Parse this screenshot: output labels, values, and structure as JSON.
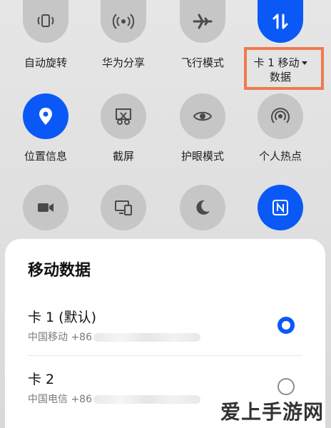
{
  "tiles": [
    {
      "label": "自动旋转",
      "icon": "rotate-lock-icon",
      "active": false
    },
    {
      "label": "华为分享",
      "icon": "share-signal-icon",
      "active": false
    },
    {
      "label": "飞行模式",
      "icon": "airplane-icon",
      "active": false
    },
    {
      "label_line1": "卡 1 移动",
      "label_line2": "数据",
      "icon": "mobile-data-icon",
      "active": true
    },
    {
      "label": "位置信息",
      "icon": "location-pin-icon",
      "active": true
    },
    {
      "label": "截屏",
      "icon": "screenshot-scissors-icon",
      "active": false
    },
    {
      "label": "护眼模式",
      "icon": "eye-icon",
      "active": false
    },
    {
      "label": "个人热点",
      "icon": "hotspot-icon",
      "active": false
    },
    {
      "icon": "video-camera-icon",
      "active": false
    },
    {
      "icon": "multi-screen-icon",
      "active": false
    },
    {
      "icon": "moon-icon",
      "active": false
    },
    {
      "icon": "nfc-icon",
      "active": true
    }
  ],
  "sheet": {
    "title": "移动数据",
    "options": [
      {
        "title": "卡 1 (默认)",
        "subtitle_prefix": "中国移动 +86",
        "checked": true
      },
      {
        "title": "卡 2",
        "subtitle_prefix": "中国电信 +86",
        "checked": false
      }
    ]
  },
  "watermark": "爱上手游网",
  "colors": {
    "accent": "#0a59f7",
    "highlight_box": "#ef7a4e",
    "tile_off": "#c6c6c6"
  }
}
